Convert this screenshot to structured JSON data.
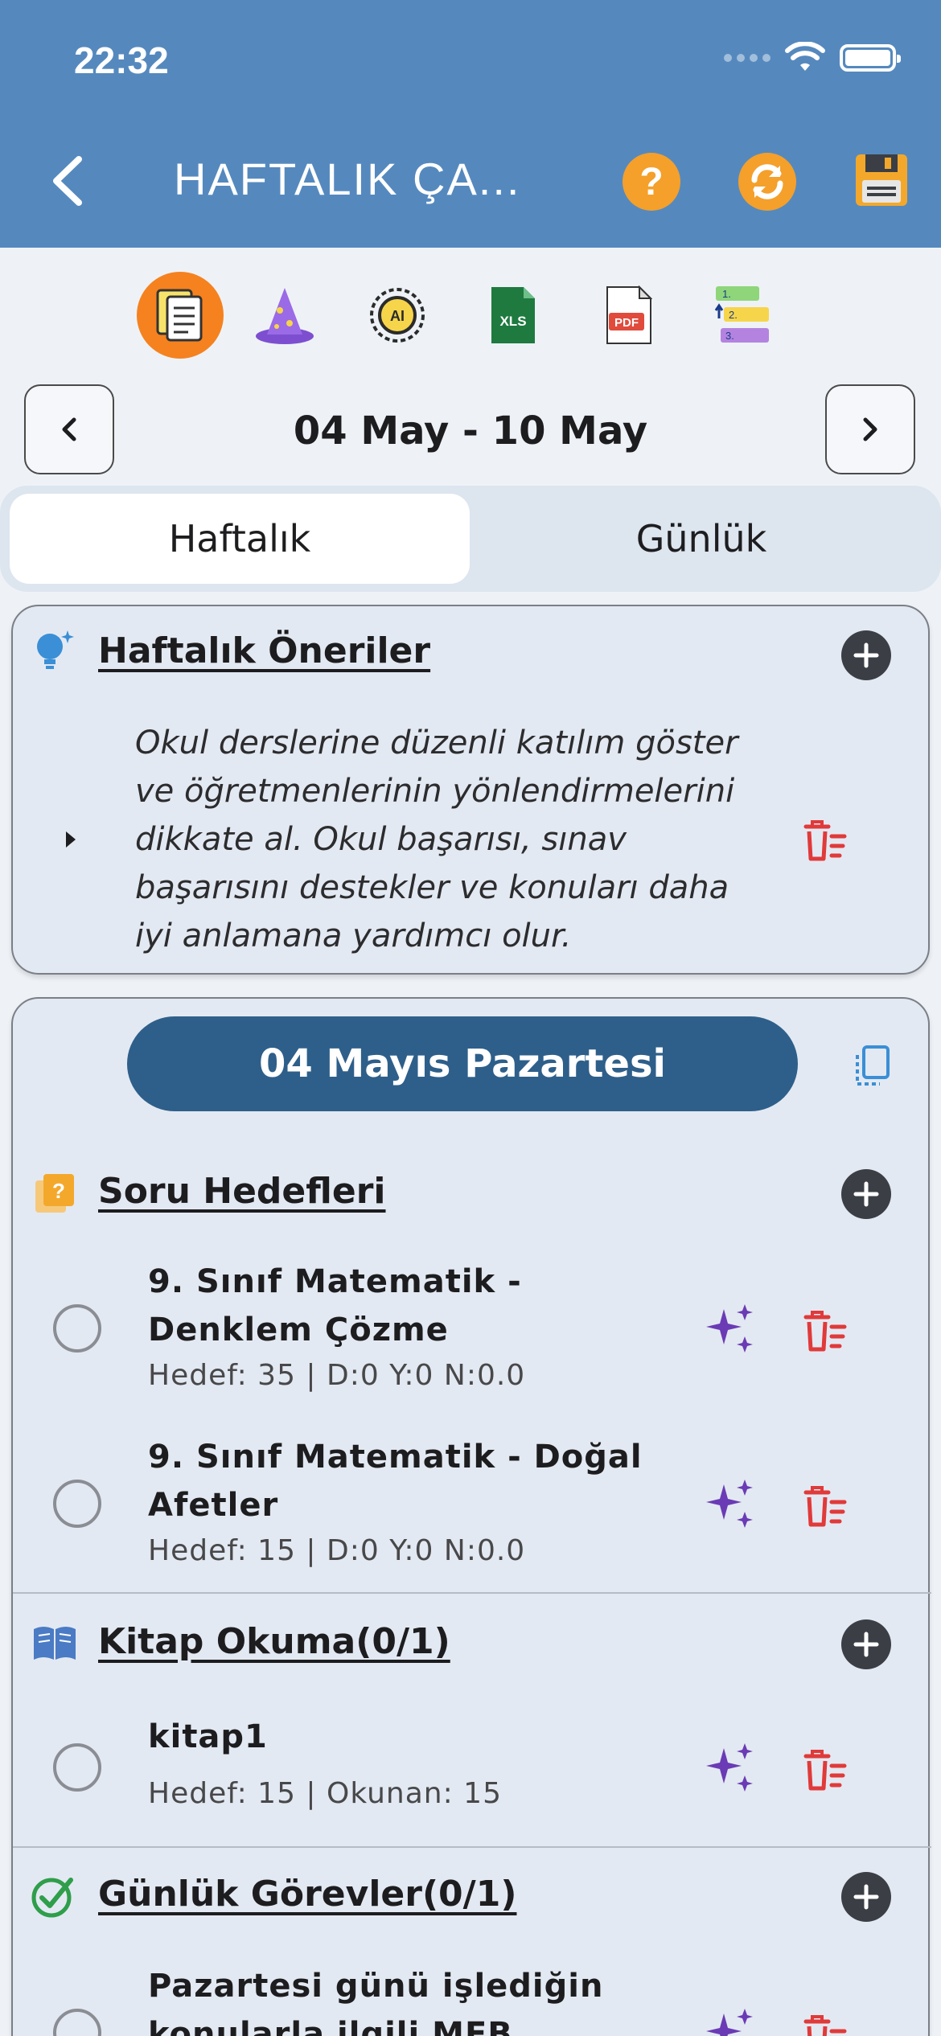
{
  "status_bar": {
    "time": "22:32"
  },
  "header": {
    "title": "HAFTALIK ÇA...",
    "help_glyph": "?"
  },
  "toolbar": {
    "icons": [
      "clipboard-icon",
      "wizard-hat-icon",
      "ai-gear-icon",
      "xls-file-icon",
      "pdf-file-icon",
      "numbered-list-icon"
    ],
    "xls_label": "XLS",
    "pdf_label": "PDF",
    "ai_label": "AI",
    "list_numbers": [
      "1.",
      "2.",
      "3."
    ]
  },
  "date_nav": {
    "range": "04 May - 10 May"
  },
  "tabs": [
    {
      "label": "Haftalık",
      "active": true
    },
    {
      "label": "Günlük",
      "active": false
    }
  ],
  "suggestions": {
    "title": "Haftalık Öneriler",
    "text": "Okul derslerine düzenli katılım göster ve öğretmenlerinin yönlendirmelerini dikkate al. Okul başarısı, sınav başarısını destekler ve konuları daha iyi anlamana yardımcı olur."
  },
  "day": {
    "label": "04 Mayıs Pazartesi",
    "sections": {
      "questions": {
        "title": "Soru Hedefleri",
        "items": [
          {
            "title": "9. Sınıf Matematik - Denklem Çözme",
            "subtitle": "Hedef: 35 | D:0 Y:0 N:0.0"
          },
          {
            "title": "9. Sınıf Matematik - Doğal Afetler",
            "subtitle": "Hedef: 15 | D:0 Y:0 N:0.0"
          }
        ]
      },
      "reading": {
        "title": "Kitap Okuma(0/1)",
        "items": [
          {
            "title": "kitap1",
            "subtitle": "Hedef: 15 | Okunan: 15"
          }
        ]
      },
      "tasks": {
        "title": "Günlük Görevler(0/1)",
        "items": [
          {
            "title": "Pazartesi günü işlediğin konularla ilgili MEB kazanım"
          }
        ]
      }
    }
  },
  "colors": {
    "header": "#5589be",
    "accent_orange": "#f4a02b",
    "pill": "#2e5f8a",
    "delete_red": "#e03a3a",
    "sparkle_purple": "#6a3bb5"
  }
}
